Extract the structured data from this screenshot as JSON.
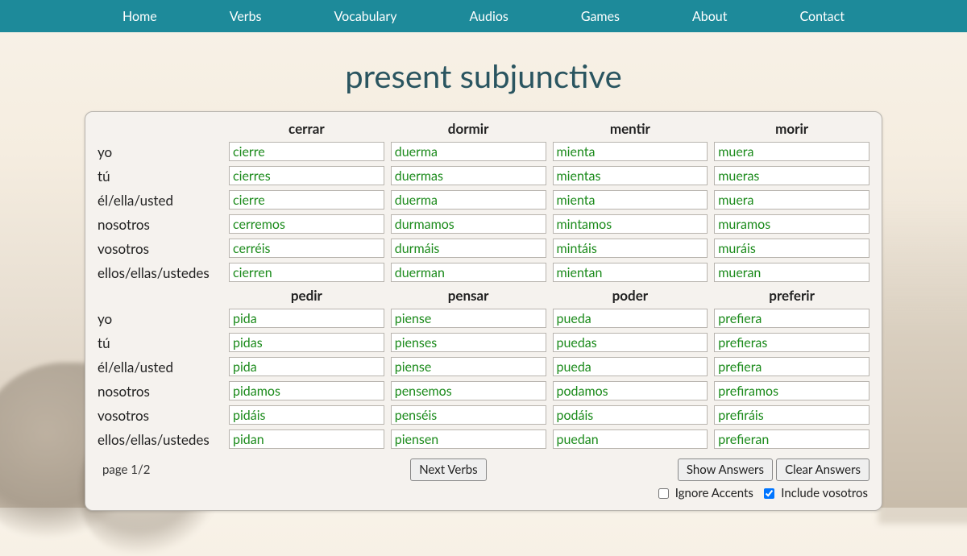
{
  "nav": {
    "items": [
      "Home",
      "Verbs",
      "Vocabulary",
      "Audios",
      "Games",
      "About",
      "Contact"
    ]
  },
  "title": "present subjunctive",
  "pronouns": [
    "yo",
    "tú",
    "él/ella/usted",
    "nosotros",
    "vosotros",
    "ellos/ellas/ustedes"
  ],
  "blocks": [
    {
      "verbs": [
        "cerrar",
        "dormir",
        "mentir",
        "morir"
      ],
      "answers": [
        [
          "cierre",
          "duerma",
          "mienta",
          "muera"
        ],
        [
          "cierres",
          "duermas",
          "mientas",
          "mueras"
        ],
        [
          "cierre",
          "duerma",
          "mienta",
          "muera"
        ],
        [
          "cerremos",
          "durmamos",
          "mintamos",
          "muramos"
        ],
        [
          "cerréis",
          "durmáis",
          "mintáis",
          "muráis"
        ],
        [
          "cierren",
          "duerman",
          "mientan",
          "mueran"
        ]
      ]
    },
    {
      "verbs": [
        "pedir",
        "pensar",
        "poder",
        "preferir"
      ],
      "answers": [
        [
          "pida",
          "piense",
          "pueda",
          "prefiera"
        ],
        [
          "pidas",
          "pienses",
          "puedas",
          "prefieras"
        ],
        [
          "pida",
          "piense",
          "pueda",
          "prefiera"
        ],
        [
          "pidamos",
          "pensemos",
          "podamos",
          "prefiramos"
        ],
        [
          "pidáis",
          "penséis",
          "podáis",
          "prefiráis"
        ],
        [
          "pidan",
          "piensen",
          "puedan",
          "prefieran"
        ]
      ]
    }
  ],
  "footer": {
    "page_indicator": "page 1/2",
    "next_verbs": "Next Verbs",
    "show_answers": "Show Answers",
    "clear_answers": "Clear Answers",
    "ignore_accents": "Ignore Accents",
    "include_vosotros": "Include vosotros",
    "ignore_accents_checked": false,
    "include_vosotros_checked": true
  }
}
